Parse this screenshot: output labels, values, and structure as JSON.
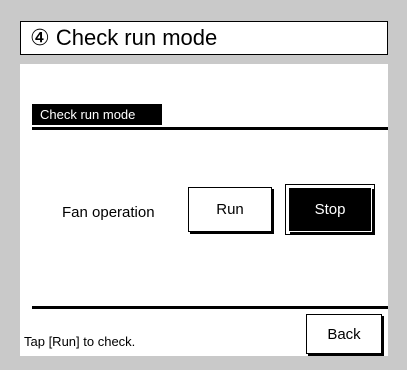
{
  "header": {
    "title": "④ Check run mode"
  },
  "section": {
    "label": "Check run mode"
  },
  "fan": {
    "label": "Fan operation",
    "run_label": "Run",
    "stop_label": "Stop",
    "selected": "Stop"
  },
  "footer": {
    "hint": "Tap [Run] to check.",
    "back_label": "Back"
  }
}
